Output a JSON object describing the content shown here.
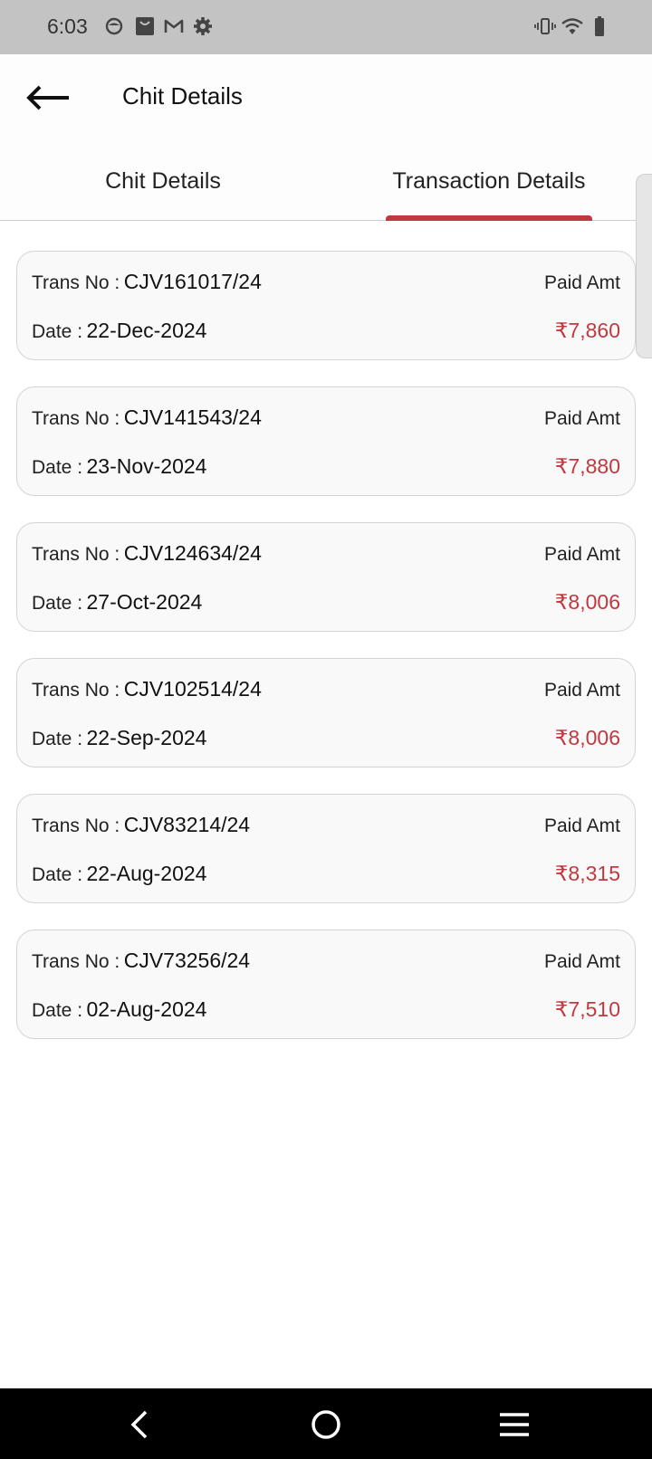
{
  "status_bar": {
    "time": "6:03",
    "icons": [
      "app-icon",
      "bag-icon",
      "gmail-icon",
      "settings-icon",
      "vibrate-icon",
      "wifi-icon",
      "battery-icon"
    ]
  },
  "app_bar": {
    "title": "Chit Details",
    "back_icon": "arrow-left-icon"
  },
  "tabs": [
    {
      "label": "Chit Details",
      "active": false
    },
    {
      "label": "Transaction Details",
      "active": true
    }
  ],
  "colors": {
    "accent": "#c0393f",
    "status_bar_bg": "#c3c3c3",
    "card_bg": "#f9f9f9",
    "nav_bar_bg": "#000000"
  },
  "labels": {
    "trans_no": "Trans No :",
    "date": "Date :",
    "paid_amt": "Paid Amt"
  },
  "transactions": [
    {
      "trans_no": "CJV161017/24",
      "date": "22-Dec-2024",
      "amount": "₹7,860"
    },
    {
      "trans_no": "CJV141543/24",
      "date": "23-Nov-2024",
      "amount": "₹7,880"
    },
    {
      "trans_no": "CJV124634/24",
      "date": "27-Oct-2024",
      "amount": "₹8,006"
    },
    {
      "trans_no": "CJV102514/24",
      "date": "22-Sep-2024",
      "amount": "₹8,006"
    },
    {
      "trans_no": "CJV83214/24",
      "date": "22-Aug-2024",
      "amount": "₹8,315"
    },
    {
      "trans_no": "CJV73256/24",
      "date": "02-Aug-2024",
      "amount": "₹7,510"
    }
  ],
  "nav_bar": {
    "icons": [
      "back-nav-icon",
      "home-nav-icon",
      "menu-nav-icon"
    ]
  }
}
